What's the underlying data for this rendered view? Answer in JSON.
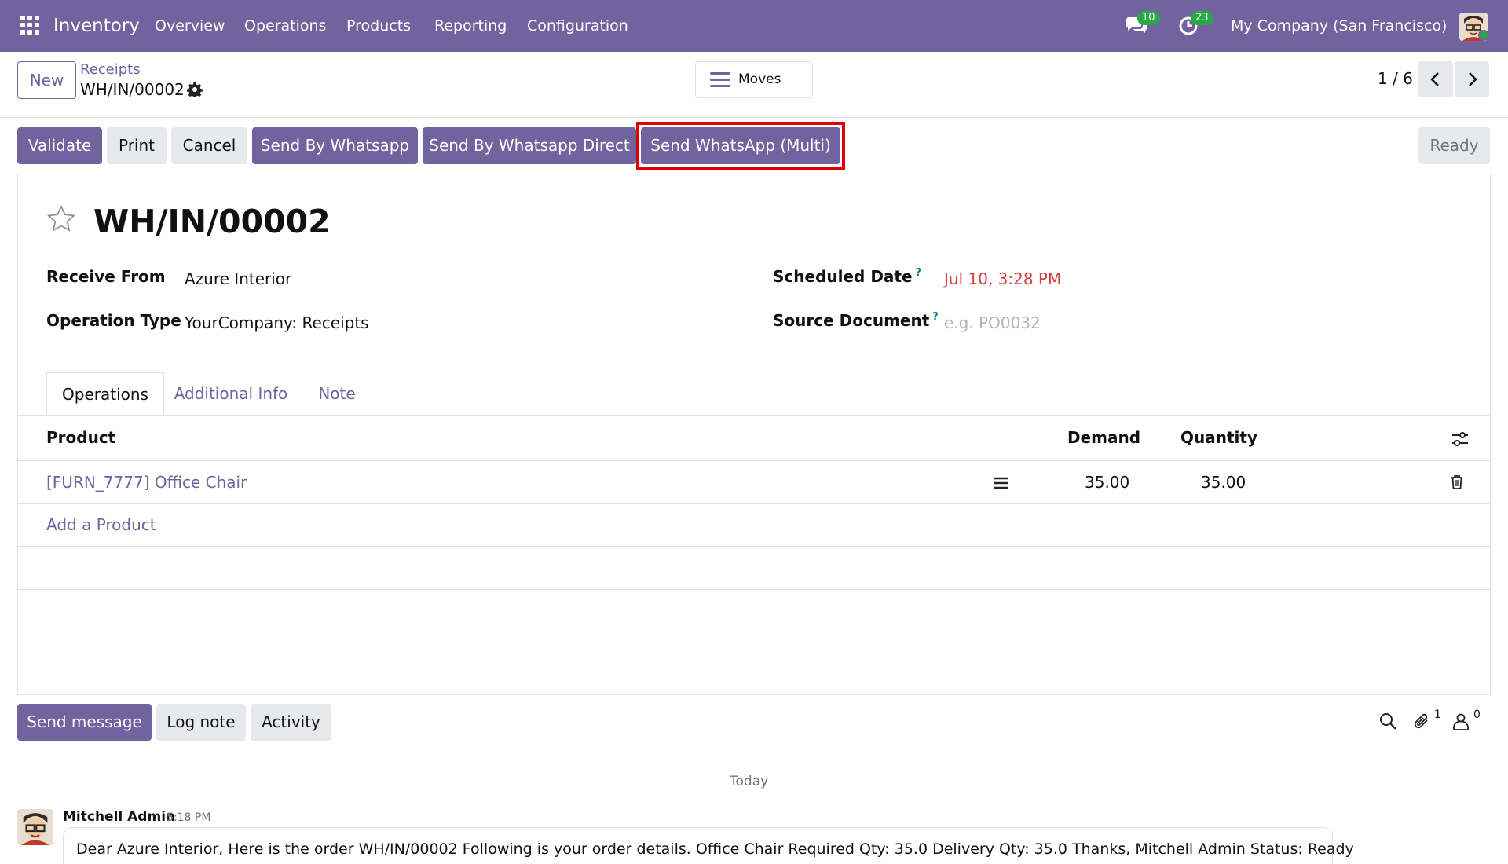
{
  "navbar": {
    "app_name": "Inventory",
    "menu": [
      "Overview",
      "Operations",
      "Products",
      "Reporting",
      "Configuration"
    ],
    "messages_count": "10",
    "activities_count": "23",
    "company": "My Company (San Francisco)",
    "bg_color": "#71639e",
    "badge_color": "#28a745"
  },
  "control_panel": {
    "new_label": "New",
    "breadcrumb_parent": "Receipts",
    "breadcrumb_current": "WH/IN/00002",
    "moves_label": "Moves",
    "pager": "1 / 6"
  },
  "actions": {
    "validate": "Validate",
    "print": "Print",
    "cancel": "Cancel",
    "send_whatsapp": "Send By Whatsapp",
    "send_whatsapp_direct": "Send By Whatsapp Direct",
    "send_whatsapp_multi": "Send WhatsApp (Multi)",
    "status": "Ready",
    "highlight_color": "#e00000"
  },
  "form": {
    "title": "WH/IN/00002",
    "receive_from_label": "Receive From",
    "receive_from_value": "Azure Interior",
    "operation_type_label": "Operation Type",
    "operation_type_value": "YourCompany: Receipts",
    "scheduled_date_label": "Scheduled Date",
    "scheduled_date_value": "Jul 10, 3:28 PM",
    "source_document_label": "Source Document",
    "source_document_placeholder": "e.g. PO0032",
    "help_mark": "?",
    "tabs": [
      "Operations",
      "Additional Info",
      "Note"
    ],
    "table": {
      "headers": {
        "product": "Product",
        "demand": "Demand",
        "quantity": "Quantity"
      },
      "rows": [
        {
          "product": "[FURN_7777] Office Chair",
          "demand": "35.00",
          "quantity": "35.00"
        }
      ],
      "add_line": "Add a Product"
    }
  },
  "chatter": {
    "send_message": "Send message",
    "log_note": "Log note",
    "activity": "Activity",
    "attachments_count": "1",
    "followers_count": "0",
    "date_separator": "Today",
    "message": {
      "author": "Mitchell Admin",
      "time": "5:18 PM",
      "body": "Dear Azure Interior, Here is the order WH/IN/00002 Following is your order details. Office Chair Required Qty: 35.0 Delivery Qty: 35.0 Thanks, Mitchell Admin Status: Ready"
    }
  }
}
